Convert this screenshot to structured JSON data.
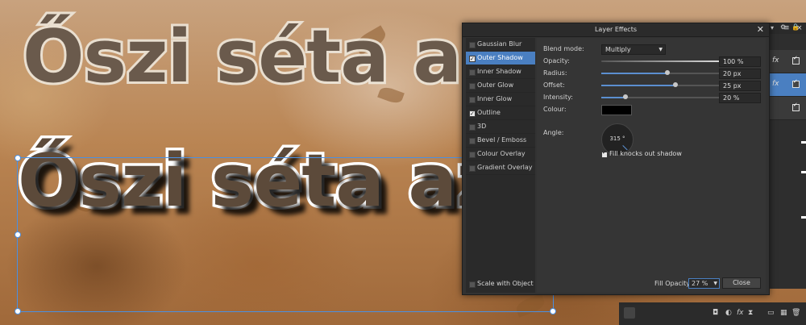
{
  "canvas": {
    "headline_ghost": "Őszi séta az",
    "headline_selected": "Őszi séta az"
  },
  "dialog": {
    "title": "Layer Effects",
    "effects": [
      {
        "label": "Gaussian Blur",
        "checked": false,
        "selected": false
      },
      {
        "label": "Outer Shadow",
        "checked": true,
        "selected": true
      },
      {
        "label": "Inner Shadow",
        "checked": false,
        "selected": false
      },
      {
        "label": "Outer Glow",
        "checked": false,
        "selected": false
      },
      {
        "label": "Inner Glow",
        "checked": false,
        "selected": false
      },
      {
        "label": "Outline",
        "checked": true,
        "selected": false
      },
      {
        "label": "3D",
        "checked": false,
        "selected": false
      },
      {
        "label": "Bevel / Emboss",
        "checked": false,
        "selected": false
      },
      {
        "label": "Colour Overlay",
        "checked": false,
        "selected": false
      },
      {
        "label": "Gradient Overlay",
        "checked": false,
        "selected": false
      }
    ],
    "blend_mode": {
      "label": "Blend mode:",
      "value": "Multiply"
    },
    "opacity": {
      "label": "Opacity:",
      "value": "100 %",
      "level": 1.0
    },
    "radius": {
      "label": "Radius:",
      "value": "20 px",
      "level": 0.55
    },
    "offset": {
      "label": "Offset:",
      "value": "25 px",
      "level": 0.62
    },
    "intensity": {
      "label": "Intensity:",
      "value": "20 %",
      "level": 0.2
    },
    "colour": {
      "label": "Colour:",
      "value": "#000000"
    },
    "angle": {
      "label": "Angle:",
      "value": "315 °"
    },
    "fill_knocks": {
      "label": "Fill knocks out shadow",
      "checked": true
    },
    "scale_with_object": {
      "label": "Scale with Object",
      "checked": false
    },
    "fill_opacity": {
      "label": "Fill Opacity:",
      "value": "27 %"
    },
    "close_label": "Close"
  },
  "colors": {
    "accent": "#4a7fc1",
    "dialog_bg": "#323232",
    "selection": "#4a90e2"
  }
}
